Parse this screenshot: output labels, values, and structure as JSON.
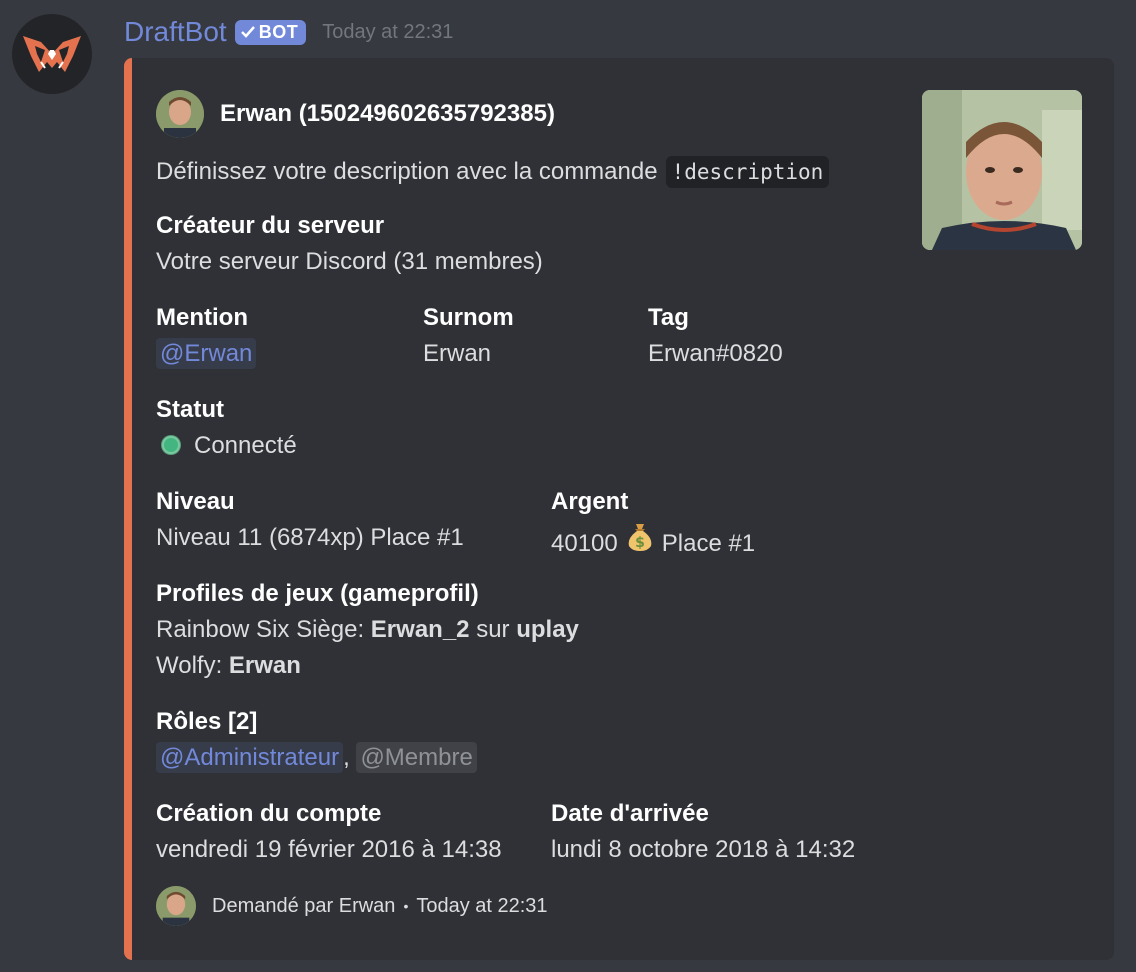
{
  "message": {
    "bot_name": "DraftBot",
    "bot_tag": "BOT",
    "timestamp": "Today at 22:31",
    "colors": {
      "accent": "#7289da",
      "embed_border": "#e4724f",
      "status_online": "#43b581"
    }
  },
  "embed": {
    "author_name": "Erwan (150249602635792385)",
    "description_text": "Définissez votre description avec la commande",
    "description_code": "!description",
    "fields": {
      "creator": {
        "name": "Créateur du serveur",
        "value": "Votre serveur Discord (31 membres)"
      },
      "mention": {
        "name": "Mention",
        "value": "@Erwan"
      },
      "nickname": {
        "name": "Surnom",
        "value": "Erwan"
      },
      "tag": {
        "name": "Tag",
        "value": "Erwan#0820"
      },
      "status": {
        "name": "Statut",
        "value": "Connecté"
      },
      "level": {
        "name": "Niveau",
        "value": "Niveau 11 (6874xp) Place #1"
      },
      "money": {
        "name": "Argent",
        "amount": "40100",
        "rank": "Place #1",
        "icon": "money-bag-icon"
      },
      "game_profiles": {
        "name": "Profiles de jeux (gameprofil)",
        "line1_game": "Rainbow Six Siège:",
        "line1_user": "Erwan_2",
        "line1_sep": "sur",
        "line1_platform": "uplay",
        "line2_game": "Wolfy:",
        "line2_user": "Erwan"
      },
      "roles": {
        "name": "Rôles [2]",
        "role1": "@Administrateur",
        "separator": ",",
        "role2": "@Membre"
      },
      "account_created": {
        "name": "Création du compte",
        "value": "vendredi 19 février 2016 à 14:38"
      },
      "joined": {
        "name": "Date d'arrivée",
        "value": "lundi 8 octobre 2018 à 14:32"
      }
    },
    "footer": {
      "text": "Demandé par Erwan",
      "separator": "•",
      "timestamp": "Today at 22:31"
    }
  }
}
